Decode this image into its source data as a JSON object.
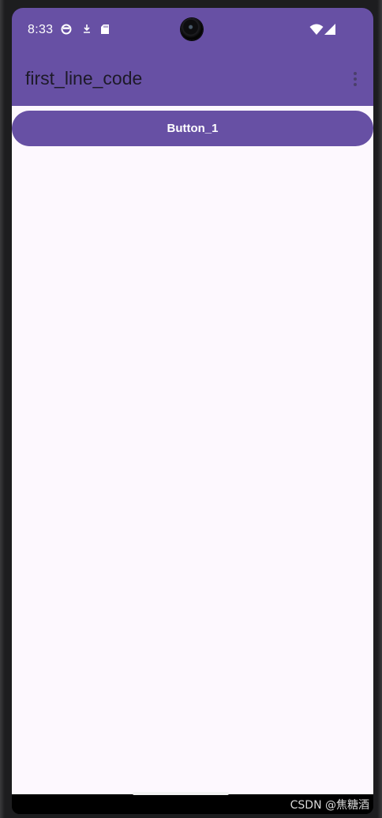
{
  "status_bar": {
    "time": "8:33",
    "left_icons": [
      "sync-circle-icon",
      "download-icon",
      "sd-card-icon"
    ],
    "right_icons": [
      "wifi-icon",
      "cellular-signal-icon"
    ]
  },
  "app_bar": {
    "title": "first_line_code",
    "overflow_icon": "more-vert-icon"
  },
  "main": {
    "button_label": "Button_1"
  },
  "watermark": "CSDN @焦糖酒",
  "colors": {
    "primary": "#6750a4",
    "background": "#fdf8fe",
    "on_primary": "#ffffff",
    "title_text": "#1d1a28"
  }
}
